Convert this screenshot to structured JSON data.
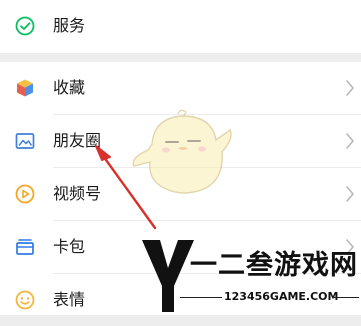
{
  "menu": {
    "items": [
      {
        "id": "services",
        "label": "服务",
        "icon": "services-icon",
        "color": "#07c160"
      },
      {
        "id": "favorites",
        "label": "收藏",
        "icon": "favorites-cube-icon",
        "color": "#f0a531"
      },
      {
        "id": "moments",
        "label": "朋友圈",
        "icon": "moments-photo-icon",
        "color": "#3f7fd8"
      },
      {
        "id": "channels",
        "label": "视频号",
        "icon": "channels-icon",
        "color": "#f5a623"
      },
      {
        "id": "cards",
        "label": "卡包",
        "icon": "card-wallet-icon",
        "color": "#2d7be5"
      },
      {
        "id": "stickers",
        "label": "表情",
        "icon": "sticker-smile-icon",
        "color": "#f2b73a"
      }
    ]
  },
  "annotation": {
    "arrow_color": "#d8302b",
    "points_to": "moments"
  },
  "watermark": {
    "title": "一二叁游戏网",
    "url": "123456GAME.COM"
  }
}
